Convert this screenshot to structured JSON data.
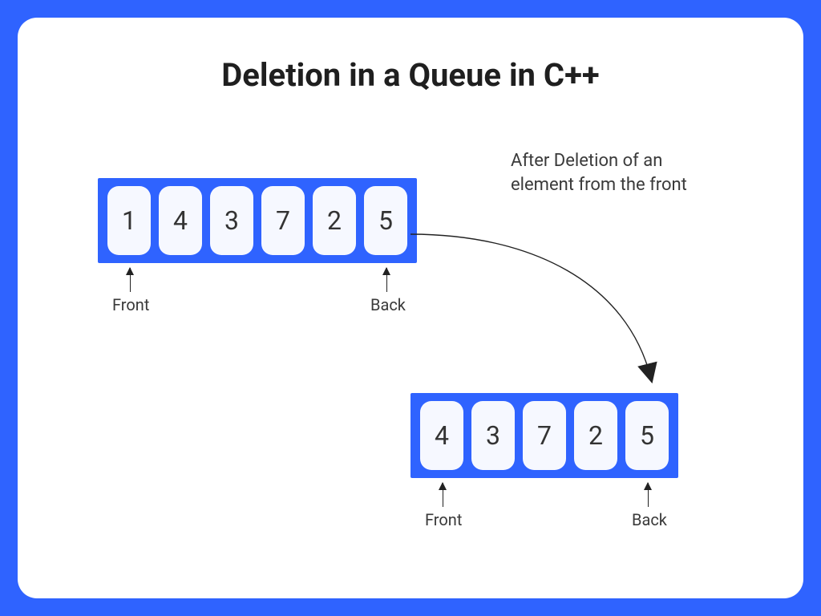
{
  "title": "Deletion in a Queue in C++",
  "caption": "After Deletion of an\nelement from the front",
  "labels": {
    "front": "Front",
    "back": "Back"
  },
  "queue_before": [
    "1",
    "4",
    "3",
    "7",
    "2",
    "5"
  ],
  "queue_after": [
    "4",
    "3",
    "7",
    "2",
    "5"
  ]
}
